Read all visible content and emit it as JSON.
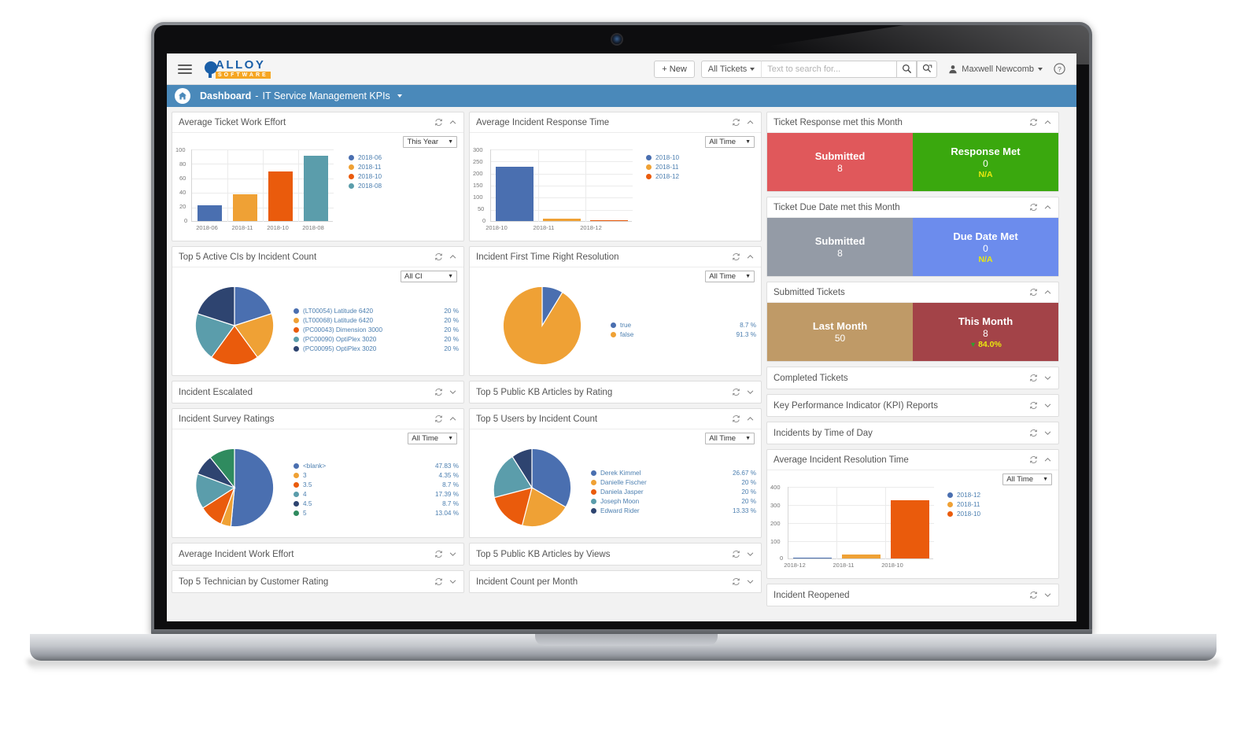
{
  "header": {
    "menu_icon": "hamburger-icon",
    "brand_top": "ALLOY",
    "brand_bottom": "SOFTWARE",
    "new_button": "+ New",
    "ticket_scope": "All Tickets",
    "search_placeholder": "Text to search for...",
    "search_value": "",
    "search_icon": "search-icon",
    "saved_search_icon": "saved-search-icon",
    "user_name": "Maxwell Newcomb",
    "user_icon": "user-avatar-icon",
    "help_icon": "help-icon"
  },
  "breadcrumb": {
    "home_icon": "home-icon",
    "root": "Dashboard",
    "separator": "-",
    "current": "IT Service Management KPIs",
    "caret_icon": "chevron-down-icon"
  },
  "icons": {
    "refresh": "refresh-icon",
    "collapse": "chevron-up-icon",
    "expand": "chevron-down-icon"
  },
  "colors": {
    "blue": "#4a6fb0",
    "orange": "#efa135",
    "red_orange": "#ea5b0c",
    "teal": "#5b9dab",
    "navy": "#2e4470",
    "green": "#2f8b5f",
    "accent_bar": "#4a89ba",
    "kpi_red": "#e0585b",
    "kpi_green": "#3aa80e",
    "kpi_gray": "#949ba6",
    "kpi_blue": "#6c8ced",
    "kpi_tan": "#bf9a67",
    "kpi_maroon": "#a34348",
    "legend_text": "#4c7fb0"
  },
  "panels": {
    "avg_ticket_work_effort": {
      "title": "Average Ticket Work Effort",
      "filter": "This Year",
      "collapsed": false
    },
    "avg_incident_response_time": {
      "title": "Average Incident Response Time",
      "filter": "All Time",
      "collapsed": false
    },
    "top5_cis": {
      "title": "Top 5 Active CIs by Incident Count",
      "filter": "All CI",
      "collapsed": false
    },
    "first_time_right": {
      "title": "Incident First Time Right Resolution",
      "filter": "All Time",
      "collapsed": false
    },
    "incident_escalated": {
      "title": "Incident Escalated",
      "collapsed": true
    },
    "top5_kb_rating": {
      "title": "Top 5 Public KB Articles by Rating",
      "collapsed": true
    },
    "survey_ratings": {
      "title": "Incident Survey Ratings",
      "filter": "All Time",
      "collapsed": false
    },
    "top5_users": {
      "title": "Top 5 Users by Incident Count",
      "filter": "All Time",
      "collapsed": false
    },
    "avg_incident_work_effort": {
      "title": "Average Incident Work Effort",
      "collapsed": true
    },
    "top5_kb_views": {
      "title": "Top 5 Public KB Articles by Views",
      "collapsed": true
    },
    "top5_technician": {
      "title": "Top 5 Technician by Customer Rating",
      "collapsed": true
    },
    "incident_count_month": {
      "title": "Incident Count per Month",
      "collapsed": true
    },
    "ticket_response_met": {
      "title": "Ticket Response met this Month",
      "collapsed": false
    },
    "ticket_due_date_met": {
      "title": "Ticket Due Date met this Month",
      "collapsed": false
    },
    "submitted_tickets": {
      "title": "Submitted Tickets",
      "collapsed": false
    },
    "completed_tickets": {
      "title": "Completed Tickets",
      "collapsed": true
    },
    "kpi_reports": {
      "title": "Key Performance Indicator (KPI) Reports",
      "collapsed": true
    },
    "incidents_time_of_day": {
      "title": "Incidents by Time of Day",
      "collapsed": true
    },
    "avg_incident_resolution_time": {
      "title": "Average Incident Resolution Time",
      "filter": "All Time",
      "collapsed": false
    },
    "incident_reopened": {
      "title": "Incident Reopened",
      "collapsed": true
    }
  },
  "kpi_tiles": {
    "ticket_response_met": [
      {
        "label": "Submitted",
        "value": "8",
        "sub": "",
        "color": "#e0585b"
      },
      {
        "label": "Response Met",
        "value": "0",
        "sub": "N/A",
        "color": "#3aa80e"
      }
    ],
    "ticket_due_date_met": [
      {
        "label": "Submitted",
        "value": "8",
        "sub": "",
        "color": "#949ba6"
      },
      {
        "label": "Due Date Met",
        "value": "0",
        "sub": "N/A",
        "color": "#6c8ced"
      }
    ],
    "submitted_tickets": [
      {
        "label": "Last Month",
        "value": "50",
        "sub": "",
        "color": "#bf9a67"
      },
      {
        "label": "This Month",
        "value": "8",
        "sub": "84.0%",
        "color": "#a34348"
      }
    ]
  },
  "chart_data": [
    {
      "id": "avg_ticket_work_effort",
      "type": "bar",
      "title": "Average Ticket Work Effort",
      "categories": [
        "2018-06",
        "2018-11",
        "2018-10",
        "2018-08"
      ],
      "values": [
        22,
        37,
        69,
        90
      ],
      "colors": [
        "#4a6fb0",
        "#efa135",
        "#ea5b0c",
        "#5b9dab"
      ],
      "yticks": [
        0,
        20,
        40,
        60,
        80,
        100
      ],
      "ylim": [
        0,
        100
      ],
      "xlabel": "",
      "ylabel": "",
      "grid": true,
      "legend": [
        {
          "name": "2018-06",
          "color": "#4a6fb0"
        },
        {
          "name": "2018-11",
          "color": "#efa135"
        },
        {
          "name": "2018-10",
          "color": "#ea5b0c"
        },
        {
          "name": "2018-08",
          "color": "#5b9dab"
        }
      ]
    },
    {
      "id": "avg_incident_response_time",
      "type": "bar",
      "title": "Average Incident Response Time",
      "categories": [
        "2018-10",
        "2018-11",
        "2018-12"
      ],
      "values": [
        225,
        8,
        2
      ],
      "colors": [
        "#4a6fb0",
        "#efa135",
        "#ea5b0c"
      ],
      "yticks": [
        0,
        50,
        100,
        150,
        200,
        250,
        300
      ],
      "ylim": [
        0,
        300
      ],
      "grid": true,
      "legend": [
        {
          "name": "2018-10",
          "color": "#4a6fb0"
        },
        {
          "name": "2018-11",
          "color": "#efa135"
        },
        {
          "name": "2018-12",
          "color": "#ea5b0c"
        }
      ]
    },
    {
      "id": "top5_cis",
      "type": "pie",
      "title": "Top 5 Active CIs by Incident Count",
      "labels": [
        "(LT00054) Latitude 6420",
        "(LT00068) Latitude 6420",
        "(PC00043) Dimension 3000",
        "(PC00090) OptiPlex 3020",
        "(PC00095) OptiPlex 3020"
      ],
      "values": [
        20,
        20,
        20,
        20,
        20
      ],
      "value_labels": [
        "20 %",
        "20 %",
        "20 %",
        "20 %",
        "20 %"
      ],
      "colors": [
        "#4a6fb0",
        "#efa135",
        "#ea5b0c",
        "#5b9dab",
        "#2e4470"
      ]
    },
    {
      "id": "first_time_right",
      "type": "pie",
      "title": "Incident First Time Right Resolution",
      "labels": [
        "true",
        "false"
      ],
      "values": [
        8.7,
        91.3
      ],
      "value_labels": [
        "8.7 %",
        "91.3 %"
      ],
      "colors": [
        "#4a6fb0",
        "#efa135"
      ]
    },
    {
      "id": "survey_ratings",
      "type": "pie",
      "title": "Incident Survey Ratings",
      "labels": [
        "<blank>",
        "3",
        "3.5",
        "4",
        "4.5",
        "5"
      ],
      "values": [
        47.83,
        4.35,
        8.7,
        17.39,
        8.7,
        13.04
      ],
      "value_labels": [
        "47.83 %",
        "4.35 %",
        "8.7 %",
        "17.39 %",
        "8.7 %",
        "13.04 %"
      ],
      "colors": [
        "#4a6fb0",
        "#efa135",
        "#ea5b0c",
        "#5b9dab",
        "#2e4470",
        "#2f8b5f"
      ]
    },
    {
      "id": "top5_users",
      "type": "pie",
      "title": "Top 5 Users by Incident Count",
      "labels": [
        "Derek Kimmel",
        "Danielle Fischer",
        "Daniela Jasper",
        "Joseph Moon",
        "Edward Rider"
      ],
      "values": [
        26.67,
        20,
        20,
        20,
        13.33
      ],
      "value_labels": [
        "26.67 %",
        "20 %",
        "20 %",
        "20 %",
        "13.33 %"
      ],
      "colors": [
        "#4a6fb0",
        "#efa135",
        "#ea5b0c",
        "#5b9dab",
        "#2e4470"
      ]
    },
    {
      "id": "avg_incident_resolution_time",
      "type": "bar",
      "title": "Average Incident Resolution Time",
      "categories": [
        "2018-12",
        "2018-11",
        "2018-10"
      ],
      "values": [
        2,
        20,
        320
      ],
      "colors": [
        "#4a6fb0",
        "#efa135",
        "#ea5b0c"
      ],
      "yticks": [
        0,
        100,
        200,
        300,
        400
      ],
      "ylim": [
        0,
        400
      ],
      "grid": true,
      "legend": [
        {
          "name": "2018-12",
          "color": "#4a6fb0"
        },
        {
          "name": "2018-11",
          "color": "#efa135"
        },
        {
          "name": "2018-10",
          "color": "#ea5b0c"
        }
      ]
    }
  ]
}
